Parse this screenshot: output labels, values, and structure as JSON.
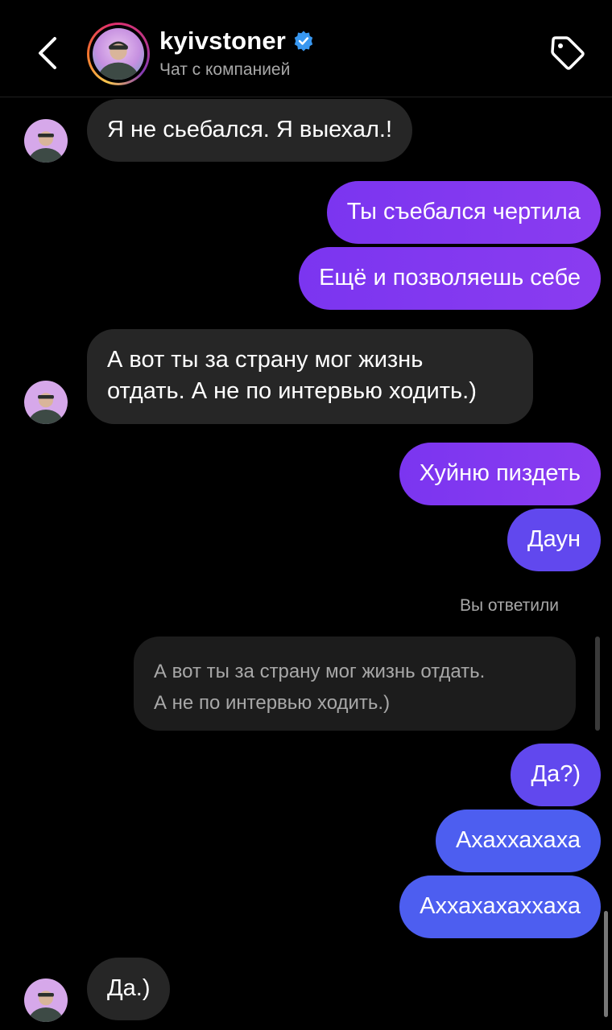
{
  "header": {
    "username": "kyivstoner",
    "subtitle": "Чат с компанией"
  },
  "messages": [
    {
      "text": "Я не сьебался. Я выехал.!",
      "direction": "incoming"
    },
    {
      "text": "Ты съебался чертила",
      "direction": "outgoing"
    },
    {
      "text": "Ещё и позволяешь себе",
      "direction": "outgoing"
    },
    {
      "text": "А вот ты за страну мог жизнь",
      "text2": "отдать. А не по интервью ходить.)",
      "direction": "incoming"
    },
    {
      "text": "Хуйню пиздеть",
      "direction": "outgoing"
    },
    {
      "text": "Даун",
      "direction": "outgoing"
    },
    {
      "text": "Да?)",
      "direction": "outgoing"
    },
    {
      "text": "Ахаххахаха",
      "direction": "outgoing"
    },
    {
      "text": "Аххахахаххаха",
      "direction": "outgoing"
    },
    {
      "text": "Да.)",
      "direction": "incoming"
    }
  ],
  "reply": {
    "label": "Вы ответили",
    "quote_line1": "А вот ты за страну мог жизнь отдать.",
    "quote_line2": "А не по интервью ходить.)"
  },
  "colors": {
    "background": "#000000",
    "incoming_bubble": "#262626",
    "outgoing_purple": "#7c3aed",
    "outgoing_indigo": "#6148ee",
    "outgoing_blue": "#4d5ef0",
    "verified": "#3897f0"
  },
  "icons": {
    "back": "chevron-left-icon",
    "verified": "verified-badge-icon",
    "tag": "tag-icon"
  }
}
